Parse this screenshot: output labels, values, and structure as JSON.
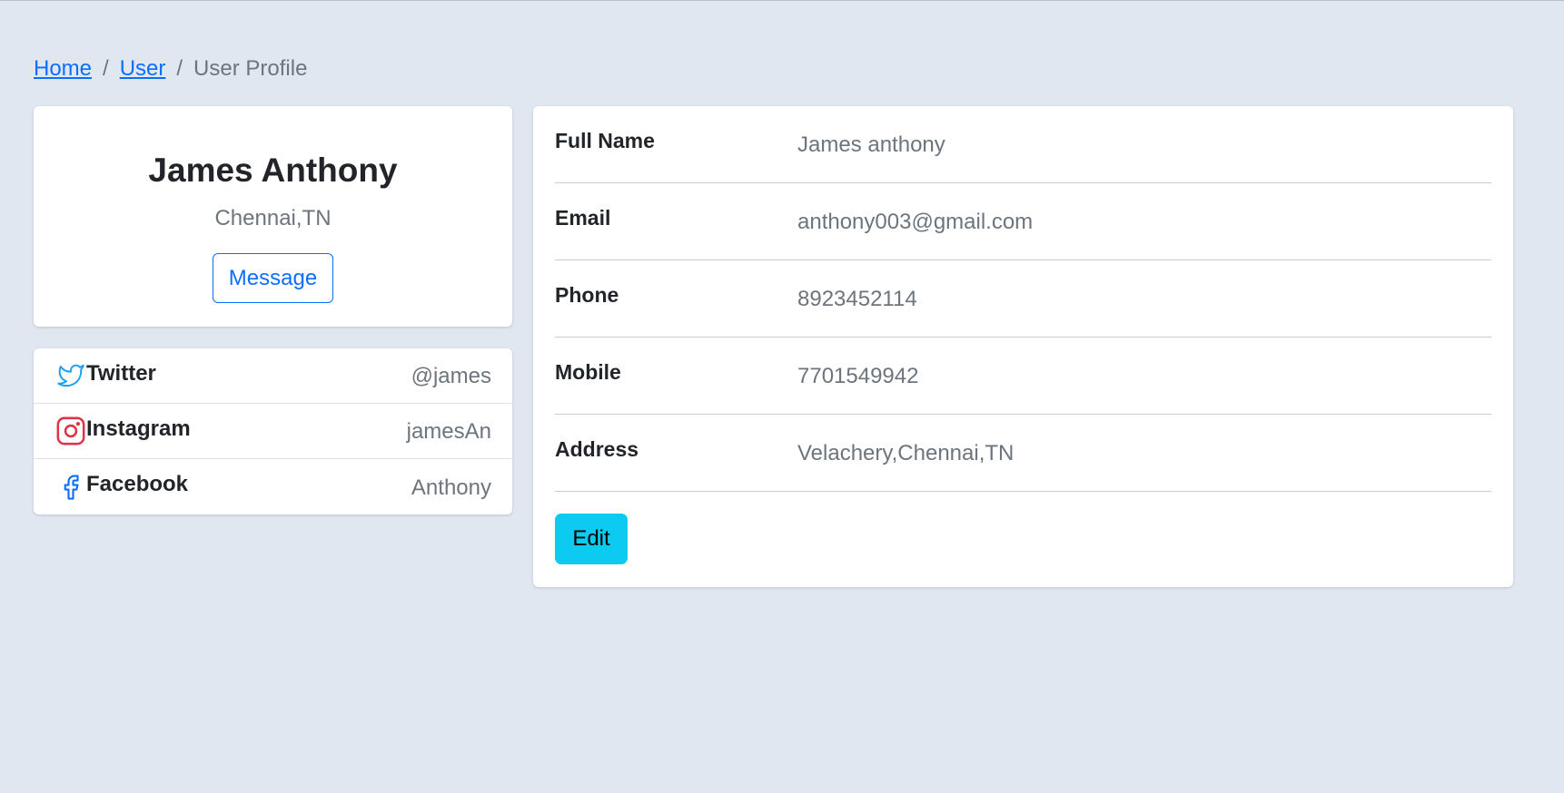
{
  "breadcrumb": {
    "home": "Home",
    "user": "User",
    "current": "User Profile",
    "separator": "/"
  },
  "profile": {
    "name": "James Anthony",
    "location": "Chennai,TN",
    "message_label": "Message"
  },
  "social": [
    {
      "name": "Twitter",
      "handle": "@james",
      "icon": "twitter-icon",
      "color": "#1da1f2"
    },
    {
      "name": "Instagram",
      "handle": "jamesAn",
      "icon": "instagram-icon",
      "color": "#dc3545"
    },
    {
      "name": "Facebook",
      "handle": "Anthony",
      "icon": "facebook-icon",
      "color": "#0d6efd"
    }
  ],
  "details": [
    {
      "label": "Full Name",
      "value": "James anthony"
    },
    {
      "label": "Email",
      "value": "anthony003@gmail.com"
    },
    {
      "label": "Phone",
      "value": "8923452114"
    },
    {
      "label": "Mobile",
      "value": "7701549942"
    },
    {
      "label": "Address",
      "value": "Velachery,Chennai,TN"
    }
  ],
  "edit_label": "Edit",
  "colors": {
    "background": "#e0e7f0",
    "primary": "#0d6efd",
    "info": "#0dcaf0",
    "muted": "#6c757d"
  }
}
